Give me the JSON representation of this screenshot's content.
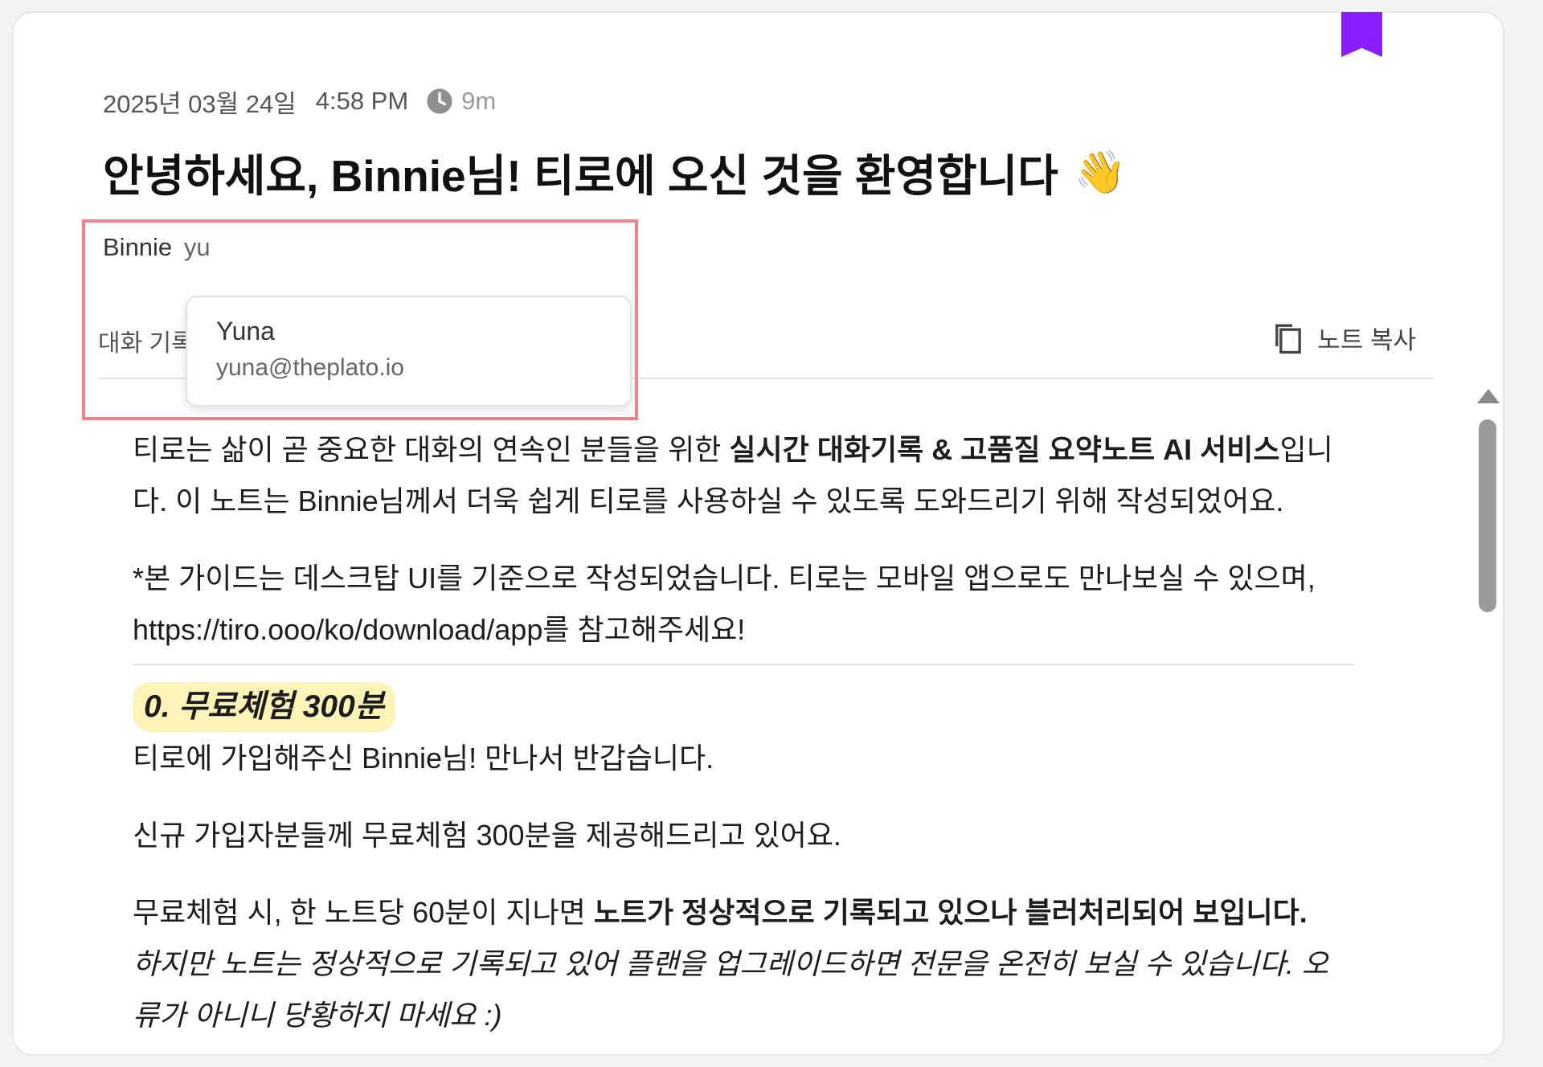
{
  "note": {
    "date": "2025년 03월 24일",
    "time": "4:58 PM",
    "duration": "9m",
    "title": "안녕하세요, Binnie님! 티로에 오신 것을 환영합니다",
    "title_emoji": "👋"
  },
  "participants": {
    "name": "Binnie",
    "input_value": "yu"
  },
  "suggestion": {
    "name": "Yuna",
    "email": "yuna@theplato.io"
  },
  "tabs": {
    "transcript_label": "대화 기록"
  },
  "toolbar": {
    "copy_label": "노트 복사"
  },
  "body": {
    "intro_a": "티로는 삶이 곧 중요한 대화의 연속인 분들을 위한 ",
    "intro_bold": "실시간 대화기록 & 고품질 요약노트 AI 서비스",
    "intro_b": "입니다. 이 노트는 Binnie님께서 더욱 쉽게 티로를 사용하실 수 있도록 도와드리기 위해 작성되었어요.",
    "guide": "*본 가이드는 데스크탑 UI를 기준으로 작성되었습니다. 티로는 모바일 앱으로도 만나보실 수 있으며, https://tiro.ooo/ko/download/app를 참고해주세요!",
    "section0_title": "0. 무료체험 300분",
    "s0_p1": "티로에 가입해주신 Binnie님! 만나서 반갑습니다.",
    "s0_p2": "신규 가입자분들께 무료체험 300분을 제공해드리고 있어요.",
    "s0_p3_a": "무료체험 시, 한 노트당 60분이 지나면 ",
    "s0_p3_bold": "노트가 정상적으로 기록되고 있으나 블러처리되어 보입니다.",
    "s0_p3_italic": "하지만 노트는 정상적으로 기록되고 있어 플랜을 업그레이드하면 전문을 온전히 보실 수 있습니다. 오류가 아니니 당황하지 마세요 :)"
  },
  "colors": {
    "bookmark": "#8a1cff",
    "highlight_border": "#f3838a",
    "section_highlight": "#fff4b8"
  },
  "icons": [
    "bookmark-icon",
    "clock-icon",
    "copy-icon",
    "scroll-up-icon"
  ]
}
